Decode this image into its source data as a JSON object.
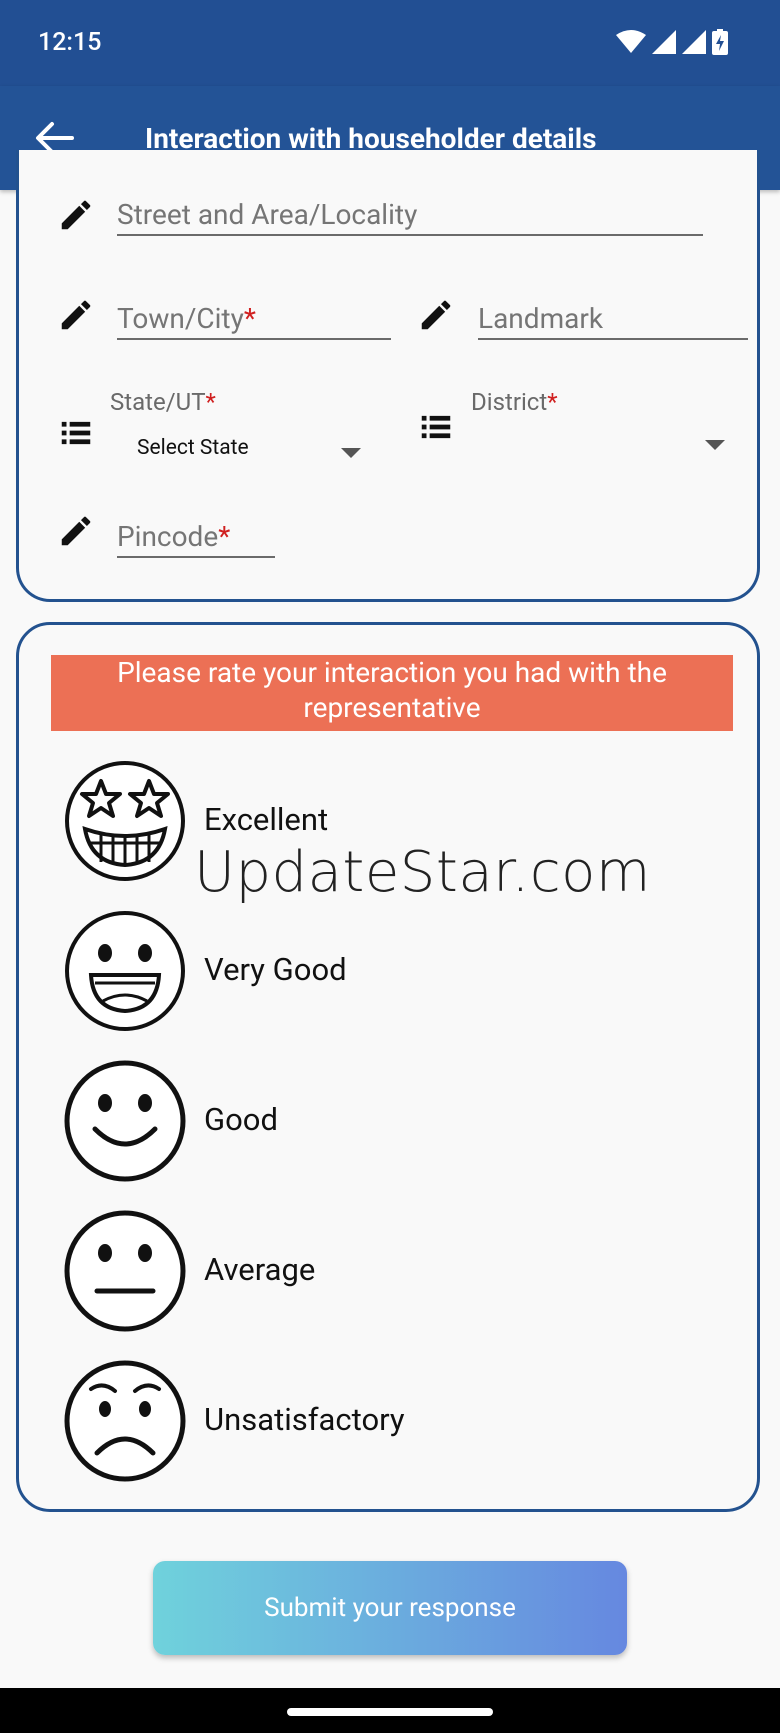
{
  "status_bar": {
    "time": "12:15"
  },
  "app_bar": {
    "title": "Interaction with householder details"
  },
  "address": {
    "street_placeholder": "Street and Area/Locality",
    "town_placeholder": "Town/City",
    "landmark_placeholder": "Landmark",
    "state_label": "State/UT",
    "state_value": "Select State",
    "district_label": "District",
    "district_value": "",
    "pincode_placeholder": "Pincode",
    "required_mark": "*"
  },
  "rating": {
    "prompt": "Please rate your interaction you had with the representative",
    "options": [
      {
        "label": "Excellent",
        "icon": "star-eyes-face-icon"
      },
      {
        "label": "Very Good",
        "icon": "grin-face-icon"
      },
      {
        "label": "Good",
        "icon": "smile-face-icon"
      },
      {
        "label": "Average",
        "icon": "neutral-face-icon"
      },
      {
        "label": "Unsatisfactory",
        "icon": "sad-face-icon"
      }
    ]
  },
  "watermark": "UpdateStar.com",
  "submit_label": "Submit your response",
  "colors": {
    "app_bar": "#235396",
    "card_border": "#23528f",
    "banner": "#ec7055",
    "required": "#d02020"
  }
}
